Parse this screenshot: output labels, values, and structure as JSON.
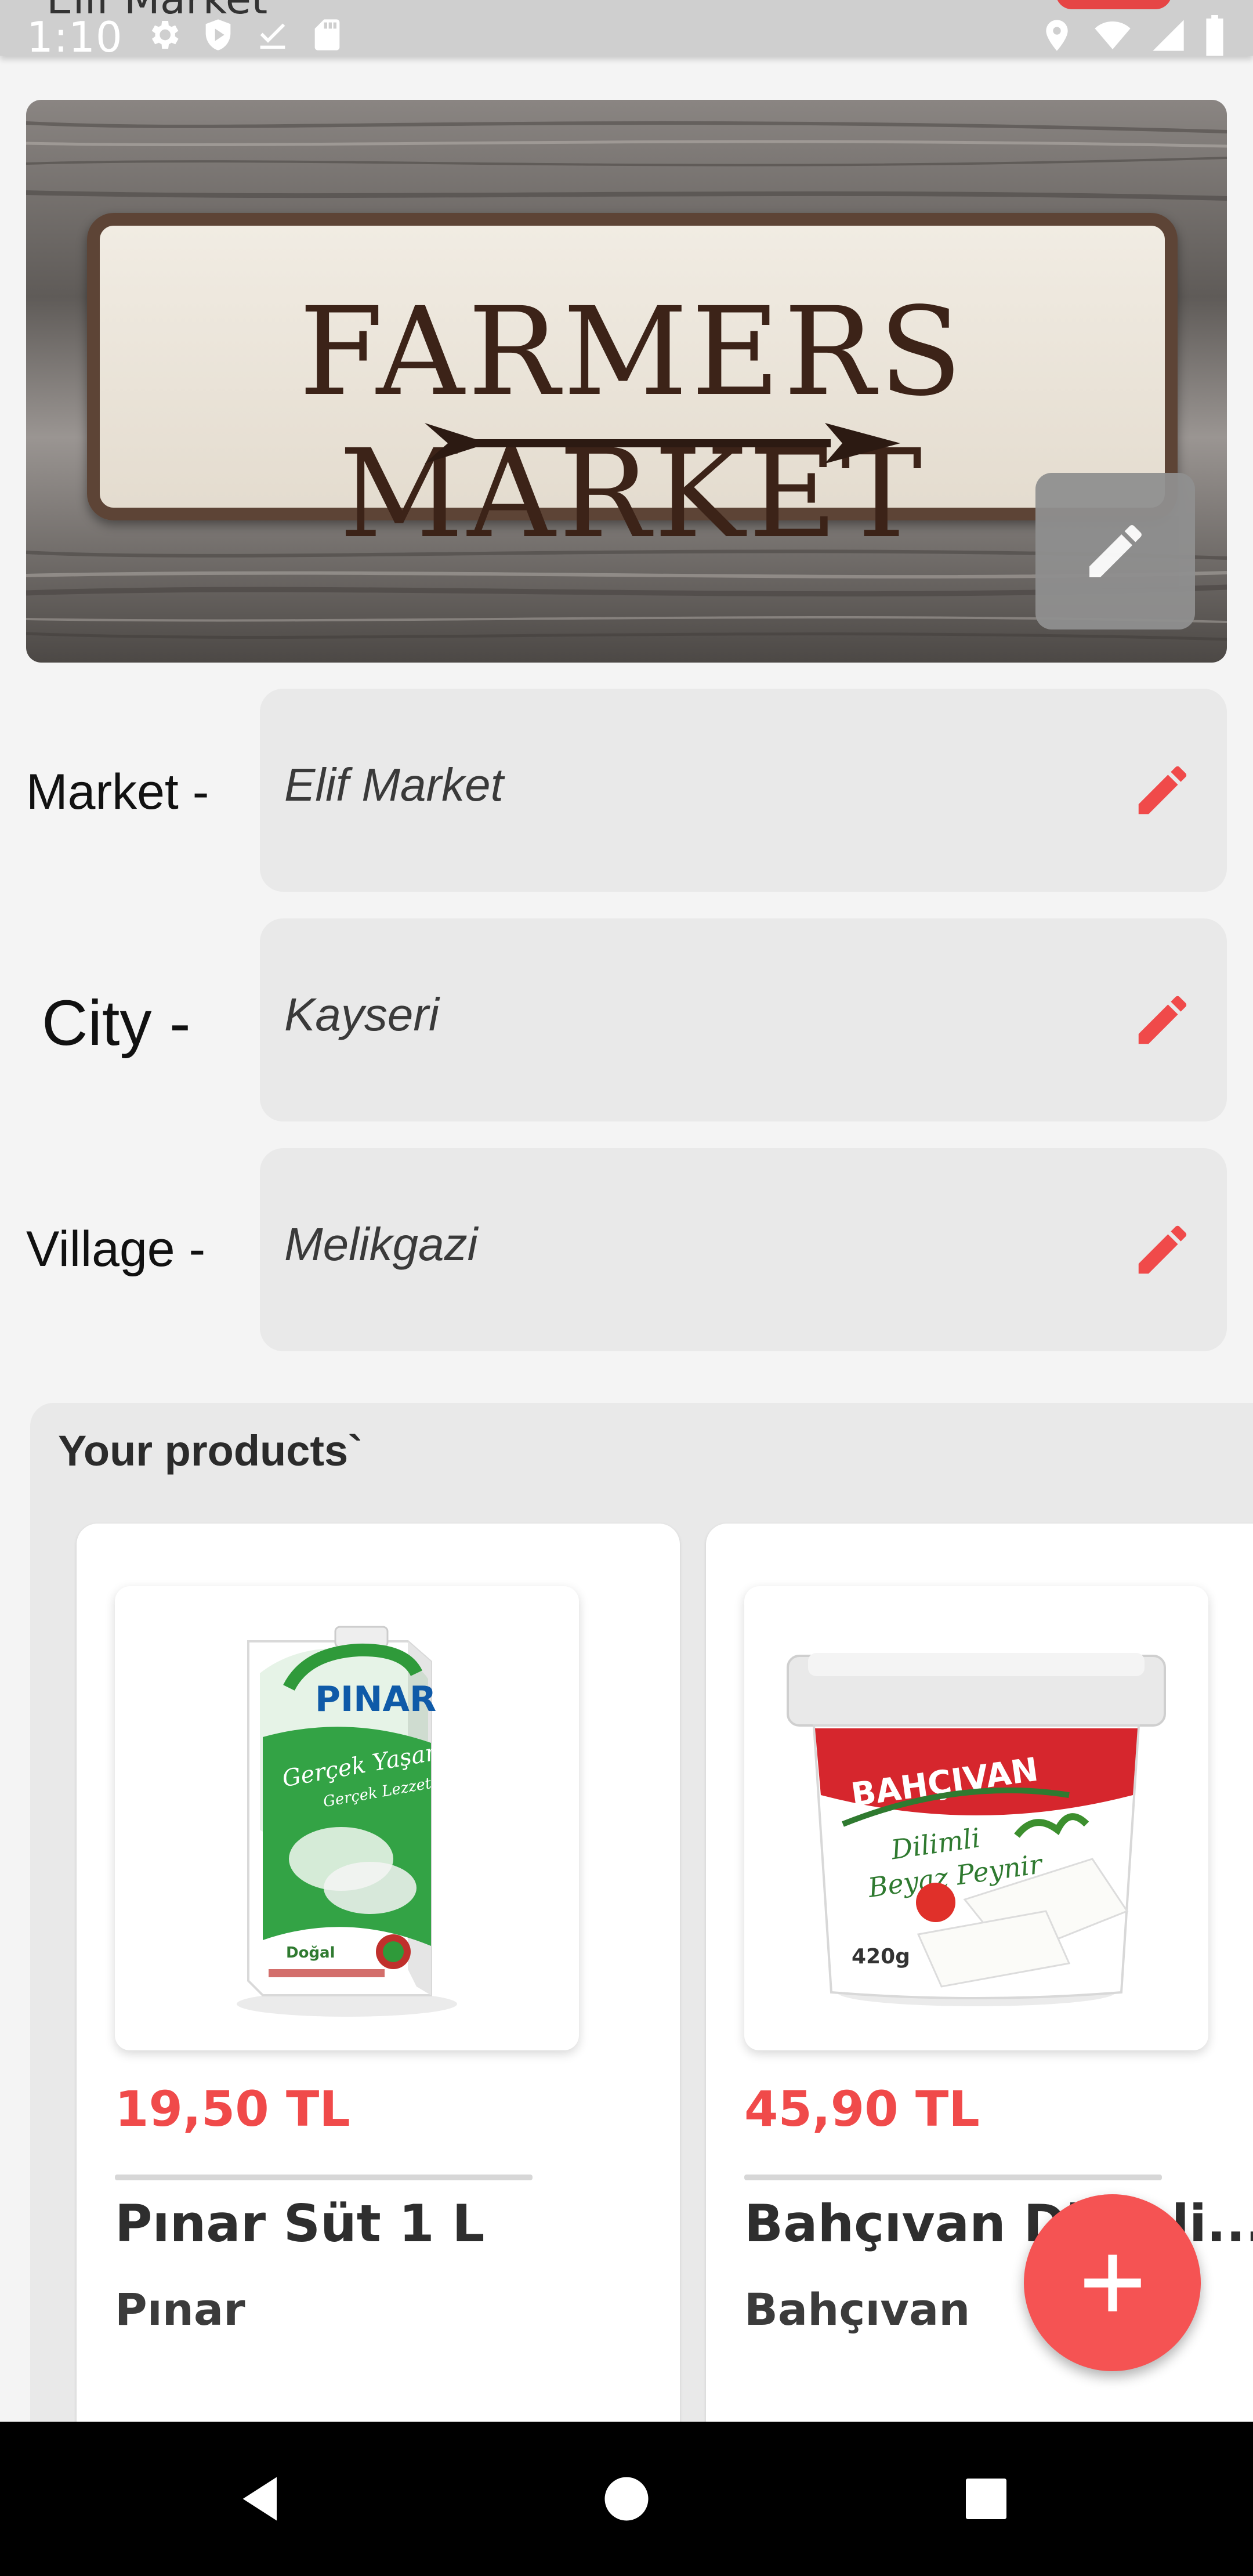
{
  "status_bar": {
    "time": "1:10",
    "app_title_partial": "Elif Market",
    "icons_left": [
      "settings-icon",
      "play-protect-icon",
      "check-icon",
      "sd-card-icon"
    ],
    "icons_right": [
      "location-icon",
      "wifi-icon",
      "signal-icon",
      "battery-icon"
    ]
  },
  "banner": {
    "sign_text": "FARMERS MARKET",
    "edit_icon": "pencil-icon"
  },
  "form": {
    "market": {
      "label": "Market -",
      "value": "Elif Market"
    },
    "city": {
      "label": "City -",
      "value": "Kayseri"
    },
    "village": {
      "label": "Village -",
      "value": "Melikgazi"
    },
    "edit_icon_color": "#f04a4a"
  },
  "products": {
    "title": "Your products`",
    "items": [
      {
        "price": "19,50 TL",
        "name": "Pınar Süt 1 L",
        "brand": "Pınar",
        "image_brand": "PINAR",
        "image_tagline": "Gerçek Yaşam",
        "image_subtagline": "Gerçek Lezzet",
        "image_badge": "Doğal"
      },
      {
        "price": "45,90 TL",
        "name": "Bahçıvan Dilimli...",
        "brand": "Bahçıvan",
        "image_brand": "BAHÇIVAN",
        "image_line1": "Dilimli",
        "image_line2": "Beyaz Peynir",
        "image_weight": "420g"
      }
    ]
  },
  "fab": {
    "icon": "plus-icon",
    "color": "#f55353"
  },
  "nav": {
    "back": "back-icon",
    "home": "home-icon",
    "recents": "recents-icon"
  },
  "colors": {
    "accent": "#f04a4a",
    "field_bg": "#e9e9e9",
    "page_bg": "#f4f4f4"
  }
}
